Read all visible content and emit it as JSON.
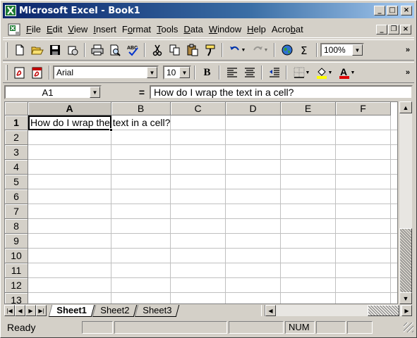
{
  "window": {
    "title": "Microsoft Excel - Book1"
  },
  "caption_buttons": {
    "minimize": "_",
    "maximize": "□",
    "close": "×"
  },
  "menu": {
    "items": [
      {
        "label": "File",
        "key": "F"
      },
      {
        "label": "Edit",
        "key": "E"
      },
      {
        "label": "View",
        "key": "V"
      },
      {
        "label": "Insert",
        "key": "I"
      },
      {
        "label": "Format",
        "key": "o"
      },
      {
        "label": "Tools",
        "key": "T"
      },
      {
        "label": "Data",
        "key": "D"
      },
      {
        "label": "Window",
        "key": "W"
      },
      {
        "label": "Help",
        "key": "H"
      },
      {
        "label": "Acrobat",
        "key": "b"
      }
    ]
  },
  "standard_toolbar": {
    "zoom": "100%",
    "icons": [
      "new-icon",
      "open-icon",
      "save-icon",
      "permission-icon",
      "print-icon",
      "print-preview-icon",
      "spelling-icon",
      "cut-icon",
      "copy-icon",
      "paste-icon",
      "format-painter-icon",
      "undo-icon",
      "redo-icon",
      "web-icon",
      "autosum-icon"
    ]
  },
  "formatting_toolbar": {
    "font": "Arial",
    "size": "10",
    "bold": "B"
  },
  "formula_bar": {
    "name_box": "A1",
    "equals": "=",
    "content": "How do I wrap the text in a cell?"
  },
  "grid": {
    "columns": [
      "A",
      "B",
      "C",
      "D",
      "E",
      "F"
    ],
    "rows": [
      "1",
      "2",
      "3",
      "4",
      "5",
      "6",
      "7",
      "8",
      "9",
      "10",
      "11",
      "12",
      "13"
    ],
    "active_cell": "A1",
    "a1_value": "How do I wrap the text in a cell?"
  },
  "sheets": {
    "tabs": [
      "Sheet1",
      "Sheet2",
      "Sheet3"
    ],
    "active": "Sheet1"
  },
  "status_bar": {
    "mode": "Ready",
    "num": "NUM"
  },
  "colors": {
    "title_bar_start": "#0a246a",
    "title_bar_end": "#a6caf0",
    "face": "#d4d0c8"
  }
}
